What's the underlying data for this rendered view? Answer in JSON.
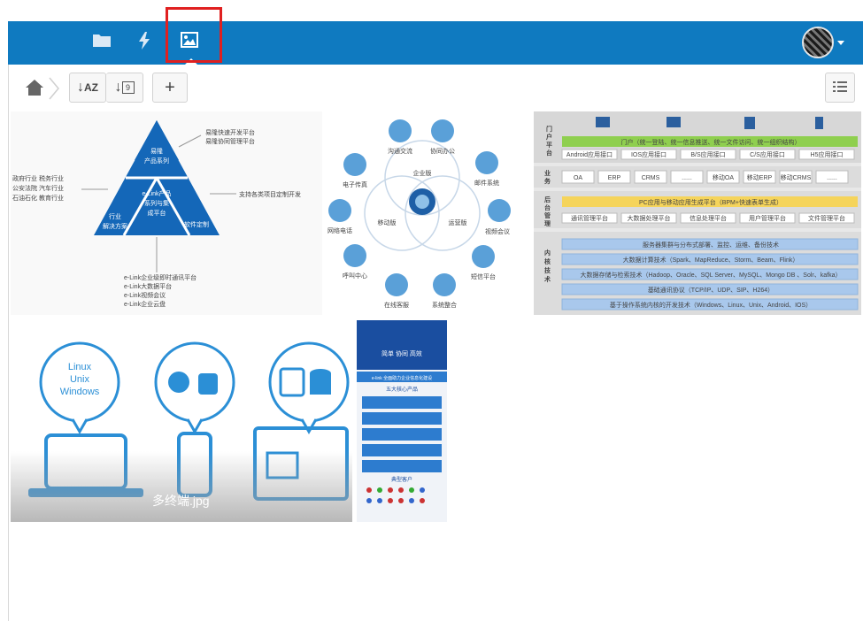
{
  "topbar": {
    "icons": [
      "folder-icon",
      "bolt-icon",
      "image-icon"
    ],
    "active_icon": "image-icon",
    "accent": "#0f7ac0",
    "highlight_color": "#e02020"
  },
  "toolbar": {
    "sort_az_label": "AZ",
    "add_label": "+",
    "calendar_day": "9"
  },
  "thumbs": {
    "pyramid": {
      "top": "易隆\n产品系列",
      "center": "e-Link产品\n系列与集\n成平台",
      "left": "行业\n解决方案",
      "right": "软件定制",
      "ann_top": "易隆快速开发平台\n易隆协同管理平台",
      "ann_left": "政府行业 税务行业\n公安法院 汽车行业\n石油石化 教育行业",
      "ann_right": "支持各类项目定制开发",
      "ann_bottom": "e-Link企业级即时通讯平台\ne-Link大数据平台\ne-Link视频会议\ne-Link企业云盘"
    },
    "venn": {
      "center_labels": [
        "企业版",
        "移动版",
        "运营版"
      ],
      "nodes": [
        "沟通交流",
        "协同办公",
        "邮件系统",
        "视频会议",
        "短信平台",
        "系统整合",
        "在线客服",
        "呼叫中心",
        "网络电话",
        "电子传真"
      ]
    },
    "arch": {
      "rows": [
        {
          "title": "门户平台",
          "header": "门户（统一登陆、统一信息推送、统一文件访问、统一组织结构）",
          "items": [
            "Android应用接口",
            "IOS应用接口",
            "B/S应用接口",
            "C/S应用接口",
            "H5应用接口"
          ]
        },
        {
          "title": "业务",
          "items": [
            "OA",
            "ERP",
            "CRMS",
            "......",
            "移动OA",
            "移动ERP",
            "移动CRMS",
            "......"
          ]
        },
        {
          "title": "后台管理",
          "header": "PC应用与移动应用生成平台（BPM+快速表单生成）",
          "items": [
            "通讯管理平台",
            "大数据处理平台",
            "信息处理平台",
            "用户管理平台",
            "文件管理平台"
          ]
        },
        {
          "title": "内核技术",
          "lines": [
            "服务器集群与分布式部署、监控、运维、备份技术",
            "大数据计算技术（Spark、MapReduce、Storm、Beam、Flink）",
            "大数据存储与检索技术（Hadoop、Oracle、SQL Server、MySQL、Mongo DB 、Solr、kafka）",
            "基础通讯协议（TCP/IP、UDP、SIP、H264）",
            "基于操作系统内核的开发技术（Windows、Linux、Unix、Android、IOS）"
          ]
        }
      ]
    },
    "multiterm": {
      "bubble_text": "Linux\nUnix\nWindows",
      "filename": "多终端.jpg"
    },
    "poster": {
      "slogan": "简单 协同 高效",
      "banner": "e-link 全面助力企业信息化建设",
      "subtitle": "五大核心产品",
      "customers": "典型客户"
    }
  }
}
